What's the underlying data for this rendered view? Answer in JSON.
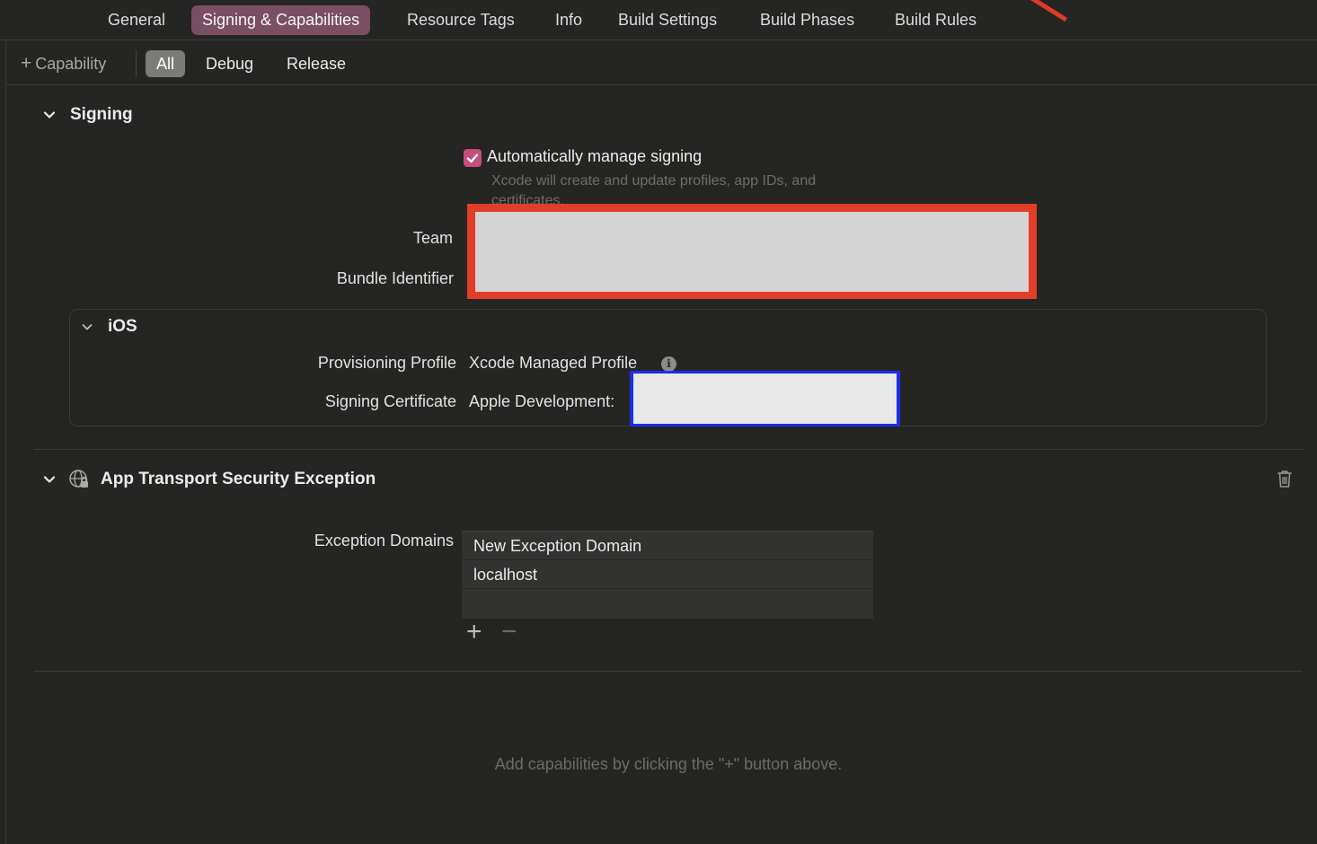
{
  "tabs": [
    "General",
    "Signing & Capabilities",
    "Resource Tags",
    "Info",
    "Build Settings",
    "Build Phases",
    "Build Rules"
  ],
  "active_tab": "Signing & Capabilities",
  "filter": {
    "capability_label": "Capability",
    "segments": [
      "All",
      "Debug",
      "Release"
    ],
    "active_segment": "All"
  },
  "signing": {
    "title": "Signing",
    "auto_manage_label": "Automatically manage signing",
    "auto_manage_checked": true,
    "auto_manage_hint": "Xcode will create and update profiles, app IDs, and certificates.",
    "team_label": "Team",
    "bundle_identifier_label": "Bundle Identifier",
    "ios": {
      "title": "iOS",
      "provisioning_profile_label": "Provisioning Profile",
      "provisioning_profile_value": "Xcode Managed Profile",
      "signing_certificate_label": "Signing Certificate",
      "signing_certificate_value": "Apple Development:"
    }
  },
  "ats": {
    "title": "App Transport Security Exception",
    "exception_domains_label": "Exception Domains",
    "domains": [
      "New Exception Domain",
      "localhost",
      ""
    ]
  },
  "footer_hint": "Add capabilities by clicking the \"+\" button above.",
  "colors": {
    "background": "#252523",
    "active_tab": "#7a4e63",
    "checkbox": "#c74d7c",
    "redaction_red": "#e23d28",
    "redaction_blue": "#1e2de8"
  }
}
